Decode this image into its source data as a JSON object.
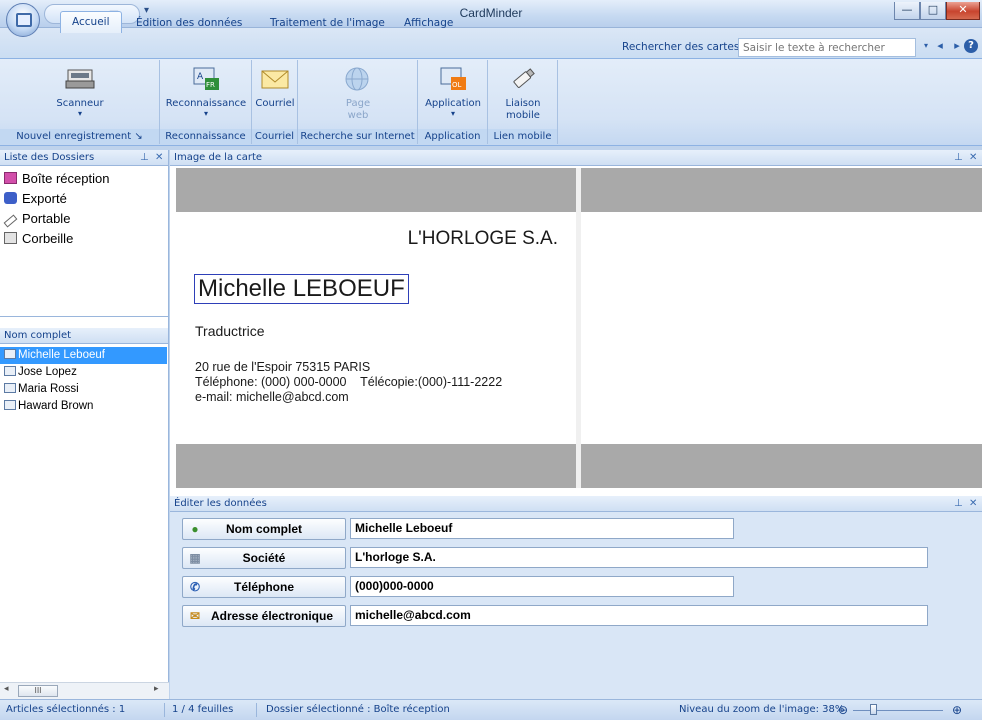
{
  "window": {
    "title": "CardMinder",
    "minimize_label": "—",
    "maximize_label": "□",
    "close_label": "✕"
  },
  "tabs": {
    "home": "Accueil",
    "edit": "Édition des données",
    "image": "Traitement de l'image",
    "view": "Affichage"
  },
  "search": {
    "label": "Rechercher des cartes :",
    "placeholder": "Saisir le texte à rechercher"
  },
  "ribbon": {
    "scanner": "Scanneur",
    "recognition": "Reconnaissance",
    "email": "Courriel",
    "web_page_line1": "Page",
    "web_page_line2": "web",
    "application": "Application",
    "mobile_line1": "Liaison",
    "mobile_line2": "mobile",
    "group_new": "Nouvel enregistrement",
    "group_recognition": "Reconnaissance",
    "group_email": "Courriel",
    "group_web": "Recherche sur Internet",
    "group_application": "Application",
    "group_mobile": "Lien mobile",
    "recognition_icon_tag": "FR",
    "application_icon_tag": "OL"
  },
  "folders": {
    "title": "Liste des Dossiers",
    "items": [
      "Boîte réception",
      "Exporté",
      "Portable",
      "Corbeille"
    ]
  },
  "cards": {
    "header": "Nom complet",
    "items": [
      "Michelle Leboeuf",
      "Jose Lopez",
      "Maria Rossi",
      "Haward Brown"
    ],
    "selected_index": 0
  },
  "card_image": {
    "title": "Image de la carte",
    "company": "L'HORLOGE S.A.",
    "name": "Michelle LEBOEUF",
    "role": "Traductrice",
    "address": "20 rue de l'Espoir 75315 PARIS",
    "phones": "Téléphone: (000) 000-0000    Télécopie:(000)-111-2222",
    "email": "e-mail: michelle@abcd.com"
  },
  "edit": {
    "title": "Éditer les données",
    "fields": [
      {
        "label": "Nom complet",
        "value": "Michelle Leboeuf"
      },
      {
        "label": "Société",
        "value": "L'horloge S.A."
      },
      {
        "label": "Téléphone",
        "value": "(000)000-0000"
      },
      {
        "label": "Adresse électronique",
        "value": "michelle@abcd.com"
      }
    ]
  },
  "status": {
    "selected": "Articles sélectionnés :   1",
    "pages": "1 /   4 feuilles",
    "folder": "Dossier sélectionné : Boîte réception",
    "zoom": "Niveau du zoom de l'image:  38%",
    "zoom_percent": 38
  },
  "scrollbar": {
    "thumb_label": "III"
  },
  "colors": {
    "accent": "#15428b",
    "selection": "#3399ff",
    "ribbon_bg": "#d5e3f5"
  }
}
